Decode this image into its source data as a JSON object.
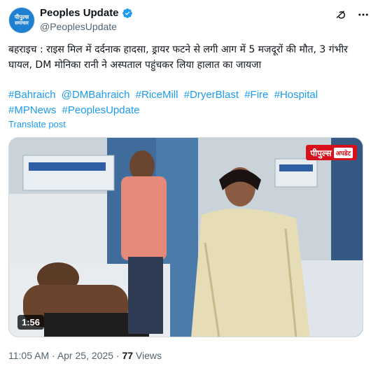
{
  "author": {
    "name": "Peoples Update",
    "handle": "@PeoplesUpdate",
    "avatar_text_1": "पीपुल्स",
    "avatar_text_2": "समाचार",
    "verified_color": "#1d9bf0"
  },
  "header_actions": [
    "grok-icon",
    "more-icon"
  ],
  "post": {
    "text": "बहराइच : राइस मिल में दर्दनाक हादसा, ड्रायर फटने से लगी आग में 5 मजदूरों की मौत, 3 गंभीर घायल, DM मोनिका रानी ने अस्पताल पहुंचकर लिया हालात का जायजा",
    "hashtags": [
      "#Bahraich",
      "@DMBahraich",
      "#RiceMill",
      "#DryerBlast",
      "#Fire",
      "#Hospital",
      "#MPNews",
      "#PeoplesUpdate"
    ],
    "translate_label": "Translate post"
  },
  "media": {
    "logo_text": "पीपुल्स",
    "logo_sub": "अपडेट",
    "duration": "1:56"
  },
  "meta": {
    "time": "11:05 AM",
    "separator": "·",
    "date": "Apr 25, 2025",
    "views_count": "77",
    "views_label": "Views"
  },
  "colors": {
    "link": "#1d9bf0",
    "muted": "#536471",
    "brand_red": "#d7111c"
  }
}
